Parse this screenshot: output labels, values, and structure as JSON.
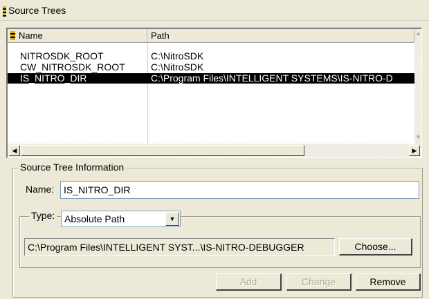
{
  "window": {
    "title": "Source Trees",
    "title_icon": "source-trees-icon"
  },
  "list": {
    "columns": [
      "Name",
      "Path"
    ],
    "header_icon": "sort-icon",
    "rows": [
      {
        "name": "NITROSDK_ROOT",
        "path": "C:\\NitroSDK",
        "selected": false
      },
      {
        "name": "CW_NITROSDK_ROOT",
        "path": "C:\\NitroSDK",
        "selected": false
      },
      {
        "name": "IS_NITRO_DIR",
        "path": "C:\\Program Files\\INTELLIGENT SYSTEMS\\IS-NITRO-D",
        "selected": true
      }
    ]
  },
  "info": {
    "group_label": "Source Tree Information",
    "name_label": "Name:",
    "name_value": "IS_NITRO_DIR",
    "type_label": "Type:",
    "type_value": "Absolute Path",
    "path_value": "C:\\Program Files\\INTELLIGENT SYST...\\IS-NITRO-DEBUGGER",
    "choose_label": "Choose..."
  },
  "actions": {
    "add": "Add",
    "change": "Change",
    "remove": "Remove"
  },
  "colors": {
    "background": "#ece9d8",
    "selection": "#000000",
    "disabled_text": "#aca899"
  }
}
